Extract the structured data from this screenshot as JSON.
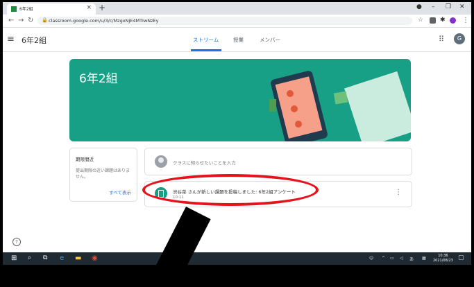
{
  "browser": {
    "tab_title": "6年2組",
    "url": "classroom.google.com/u/3/c/MzgxNjE4MTIwNzEy"
  },
  "header": {
    "class_name": "6年2組",
    "tabs": [
      {
        "label": "ストリーム",
        "active": true
      },
      {
        "label": "授業",
        "active": false
      },
      {
        "label": "メンバー",
        "active": false
      }
    ],
    "account_initial": "G"
  },
  "banner": {
    "title": "6年2組",
    "color": "#17a086"
  },
  "upcoming": {
    "title": "期限間近",
    "body": "提出期限の近い課題はありません。",
    "link": "すべて表示"
  },
  "announce": {
    "placeholder": "クラスに知らせたいことを入力"
  },
  "post": {
    "title": "渋谷菜 さんが新しい課題を投稿しました: 6年2組アンケート",
    "time": "10:11"
  },
  "taskbar": {
    "clock_time": "10:36",
    "clock_date": "2021/08/23"
  },
  "colors": {
    "accent": "#1a73e8",
    "highlight": "#e5131b"
  }
}
